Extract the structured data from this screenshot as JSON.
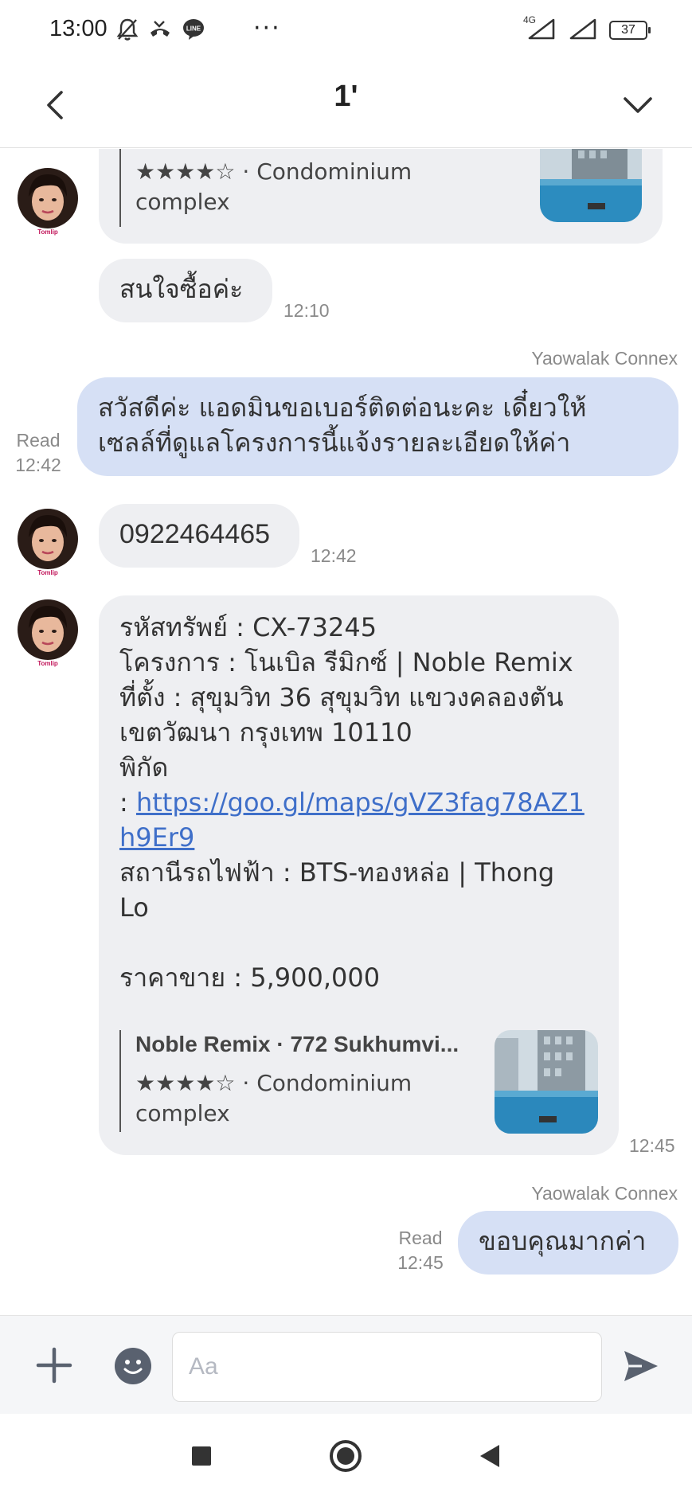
{
  "status_bar": {
    "time": "13:00",
    "dots": "···",
    "network": "4G",
    "battery": "37"
  },
  "header": {
    "title": "1'"
  },
  "colors": {
    "incoming_bubble": "#eeeff2",
    "outgoing_bubble": "#d6e0f5",
    "link": "#3f6fc9",
    "icon_gray": "#59616f"
  },
  "messages": {
    "card_top": {
      "rating": "★★★★☆ · Condominium",
      "desc2": "complex"
    },
    "m1": {
      "text": "สนใจซื้อค่ะ",
      "time": "12:10"
    },
    "m2": {
      "sender": "Yaowalak Connex",
      "line1": "สวัสดีค่ะ แอดมินขอเบอร์ติดต่อนะคะ เดี๋ยวให้",
      "line2": "เซลล์ที่ดูแลโครงการนี้แจ้งรายละเอียดให้ค่า",
      "read": "Read",
      "time": "12:42"
    },
    "m3": {
      "text": "0922464465",
      "time": "12:42"
    },
    "m4": {
      "l1": "รหัสทรัพย์ : CX-73245",
      "l2": "โครงการ : โนเบิล รีมิกซ์ | Noble Remix",
      "l3": "ที่ตั้ง :   สุขุมวิท 36 สุขุมวิท แขวงคลองตัน",
      "l4": "เขตวัฒนา กรุงเทพ 10110",
      "l5": "พิกัด",
      "l6_prefix": ": ",
      "link1": "https://goo.gl/maps/gVZ3fag78AZ1",
      "link2": "h9Er9",
      "l7": "สถานีรถไฟฟ้า : BTS-ทองหล่อ | Thong",
      "l8": "Lo",
      "l9": "ราคาขาย : 5,900,000",
      "card_title": "Noble Remix · 772 Sukhumvi...",
      "card_rating": "★★★★☆ · Condominium",
      "card_desc2": "complex",
      "time": "12:45"
    },
    "m5": {
      "sender": "Yaowalak Connex",
      "text": "ขอบคุณมากค่า",
      "read": "Read",
      "time": "12:45"
    }
  },
  "avatar_label": "Tomlip",
  "input": {
    "placeholder": "Aa"
  }
}
